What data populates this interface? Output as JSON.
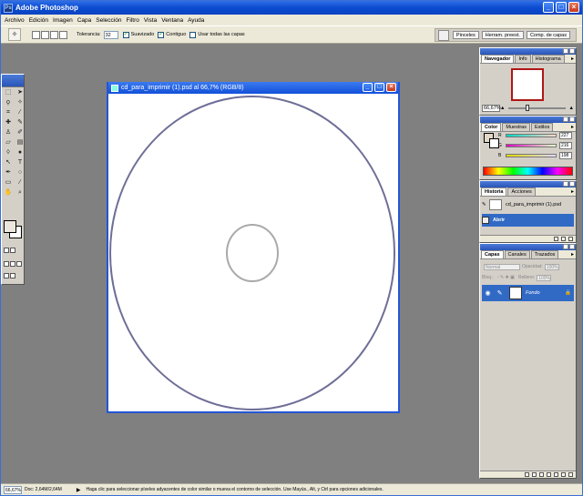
{
  "window": {
    "title": "Adobe Photoshop"
  },
  "menubar": [
    "Archivo",
    "Edición",
    "Imagen",
    "Capa",
    "Selección",
    "Filtro",
    "Vista",
    "Ventana",
    "Ayuda"
  ],
  "options": {
    "tolerance_label": "Tolerancia:",
    "tolerance_value": "32",
    "antialias_label": "Suavizado",
    "contiguous_label": "Contiguo",
    "all_layers_label": "Usar todas las capas",
    "well_tabs": [
      "Pinceles",
      "Herram. preest.",
      "Comp. de capas"
    ]
  },
  "document": {
    "title": "cd_para_imprimir (1).psd al 66,7% (RGB/8)"
  },
  "navigator": {
    "tabs": [
      "Navegador",
      "Info",
      "Histograma"
    ],
    "zoom": "66,67%"
  },
  "color": {
    "tabs": [
      "Color",
      "Muestras",
      "Estilos"
    ],
    "channels": [
      {
        "label": "R",
        "value": "227"
      },
      {
        "label": "G",
        "value": "216"
      },
      {
        "label": "B",
        "value": "198"
      }
    ]
  },
  "history": {
    "tabs": [
      "Historia",
      "Acciones"
    ],
    "snapshot": "cd_para_imprimir (1).psd",
    "state": "Abrir"
  },
  "layers": {
    "tabs": [
      "Capas",
      "Canales",
      "Trazados"
    ],
    "blend_mode": "Normal",
    "opacity_label": "Opacidad:",
    "opacity_value": "100%",
    "lock_label": "Bloq.:",
    "fill_label": "Relleno:",
    "fill_value": "100%",
    "layer_name": "Fondo"
  },
  "status": {
    "zoom": "66,67%",
    "doc": "Doc: 2,64M/2,64M",
    "hint": "Haga clic para seleccionar píxeles adyacentes de color similar o mueva el contorno de selección. Use Mayús., Alt, y Ctrl para opciones adicionales."
  }
}
